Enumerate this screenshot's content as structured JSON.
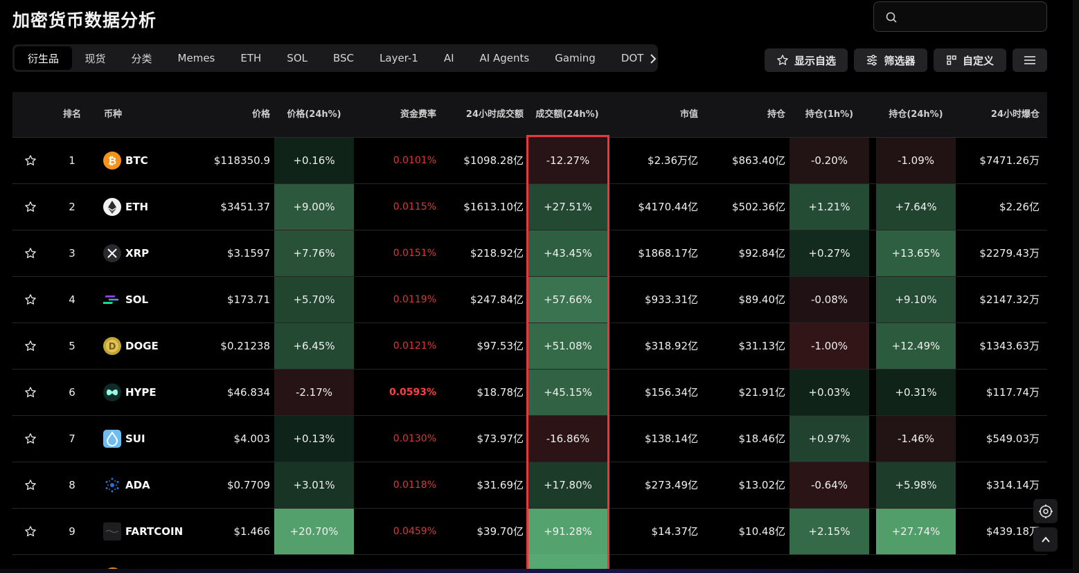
{
  "page_title": "加密货币数据分析",
  "search": {
    "placeholder": ""
  },
  "tabs": [
    "衍生品",
    "现货",
    "分类",
    "Memes",
    "ETH",
    "SOL",
    "BSC",
    "Layer-1",
    "AI",
    "AI Agents",
    "Gaming",
    "DOT"
  ],
  "active_tab": "衍生品",
  "toolbar": {
    "watchlist": "显示自选",
    "filter": "筛选器",
    "custom": "自定义"
  },
  "columns": {
    "rank": "排名",
    "coin": "币种",
    "price": "价格",
    "price_change": "价格(24h%)",
    "funding": "资金费率",
    "volume": "24小时成交额",
    "volume_change": "成交额(24h%)",
    "mcap": "市值",
    "oi": "持仓",
    "oi_1h": "持仓(1h%)",
    "oi_24h": "持仓(24h%)",
    "liq": "24小时爆仓"
  },
  "colors": {
    "up": "#2f9e5a",
    "down": "#b33a3a",
    "funding": "#d63a3a",
    "highlight_border": "#e5393b"
  },
  "rows": [
    {
      "rank": "1",
      "symbol": "BTC",
      "icon": "btc-icon",
      "price": "$118350.9",
      "price_change": "+0.16%",
      "price_change_value": 0.16,
      "funding": "0.0101%",
      "volume": "$1098.28亿",
      "volume_change": "-12.27%",
      "volume_change_value": -12.27,
      "mcap": "$2.36万亿",
      "oi": "$863.40亿",
      "oi_1h": "-0.20%",
      "oi_1h_value": -0.2,
      "oi_24h": "-1.09%",
      "oi_24h_value": -1.09,
      "liq": "$7471.26万"
    },
    {
      "rank": "2",
      "symbol": "ETH",
      "icon": "eth-icon",
      "price": "$3451.37",
      "price_change": "+9.00%",
      "price_change_value": 9.0,
      "funding": "0.0115%",
      "volume": "$1613.10亿",
      "volume_change": "+27.51%",
      "volume_change_value": 27.51,
      "mcap": "$4170.44亿",
      "oi": "$502.36亿",
      "oi_1h": "+1.21%",
      "oi_1h_value": 1.21,
      "oi_24h": "+7.64%",
      "oi_24h_value": 7.64,
      "liq": "$2.26亿"
    },
    {
      "rank": "3",
      "symbol": "XRP",
      "icon": "xrp-icon",
      "price": "$3.1597",
      "price_change": "+7.76%",
      "price_change_value": 7.76,
      "funding": "0.0151%",
      "volume": "$218.92亿",
      "volume_change": "+43.45%",
      "volume_change_value": 43.45,
      "mcap": "$1868.17亿",
      "oi": "$92.84亿",
      "oi_1h": "+0.27%",
      "oi_1h_value": 0.27,
      "oi_24h": "+13.65%",
      "oi_24h_value": 13.65,
      "liq": "$2279.43万"
    },
    {
      "rank": "4",
      "symbol": "SOL",
      "icon": "sol-icon",
      "price": "$173.71",
      "price_change": "+5.70%",
      "price_change_value": 5.7,
      "funding": "0.0119%",
      "volume": "$247.84亿",
      "volume_change": "+57.66%",
      "volume_change_value": 57.66,
      "mcap": "$933.31亿",
      "oi": "$89.40亿",
      "oi_1h": "-0.08%",
      "oi_1h_value": -0.08,
      "oi_24h": "+9.10%",
      "oi_24h_value": 9.1,
      "liq": "$2147.32万"
    },
    {
      "rank": "5",
      "symbol": "DOGE",
      "icon": "doge-icon",
      "price": "$0.21238",
      "price_change": "+6.45%",
      "price_change_value": 6.45,
      "funding": "0.0121%",
      "volume": "$97.53亿",
      "volume_change": "+51.08%",
      "volume_change_value": 51.08,
      "mcap": "$318.92亿",
      "oi": "$31.13亿",
      "oi_1h": "-1.00%",
      "oi_1h_value": -1.0,
      "oi_24h": "+12.49%",
      "oi_24h_value": 12.49,
      "liq": "$1343.63万"
    },
    {
      "rank": "6",
      "symbol": "HYPE",
      "icon": "hype-icon",
      "price": "$46.834",
      "price_change": "-2.17%",
      "price_change_value": -2.17,
      "funding": "0.0593%",
      "funding_high": true,
      "volume": "$18.78亿",
      "volume_change": "+45.15%",
      "volume_change_value": 45.15,
      "mcap": "$156.34亿",
      "oi": "$21.91亿",
      "oi_1h": "+0.03%",
      "oi_1h_value": 0.03,
      "oi_24h": "+0.31%",
      "oi_24h_value": 0.31,
      "liq": "$117.74万"
    },
    {
      "rank": "7",
      "symbol": "SUI",
      "icon": "sui-icon",
      "price": "$4.003",
      "price_change": "+0.13%",
      "price_change_value": 0.13,
      "funding": "0.0130%",
      "volume": "$73.97亿",
      "volume_change": "-16.86%",
      "volume_change_value": -16.86,
      "mcap": "$138.14亿",
      "oi": "$18.46亿",
      "oi_1h": "+0.97%",
      "oi_1h_value": 0.97,
      "oi_24h": "-1.46%",
      "oi_24h_value": -1.46,
      "liq": "$549.03万"
    },
    {
      "rank": "8",
      "symbol": "ADA",
      "icon": "ada-icon",
      "price": "$0.7709",
      "price_change": "+3.01%",
      "price_change_value": 3.01,
      "funding": "0.0118%",
      "volume": "$31.69亿",
      "volume_change": "+17.80%",
      "volume_change_value": 17.8,
      "mcap": "$273.49亿",
      "oi": "$13.02亿",
      "oi_1h": "-0.64%",
      "oi_1h_value": -0.64,
      "oi_24h": "+5.98%",
      "oi_24h_value": 5.98,
      "liq": "$314.14万"
    },
    {
      "rank": "9",
      "symbol": "FARTCOIN",
      "icon": "fartcoin-icon",
      "price": "$1.466",
      "price_change": "+20.70%",
      "price_change_value": 20.7,
      "funding": "0.0459%",
      "volume": "$39.70亿",
      "volume_change": "+91.28%",
      "volume_change_value": 91.28,
      "mcap": "$14.37亿",
      "oi": "$10.48亿",
      "oi_1h": "+2.15%",
      "oi_1h_value": 2.15,
      "oi_24h": "+27.74%",
      "oi_24h_value": 27.74,
      "liq": "$439.18万"
    }
  ]
}
